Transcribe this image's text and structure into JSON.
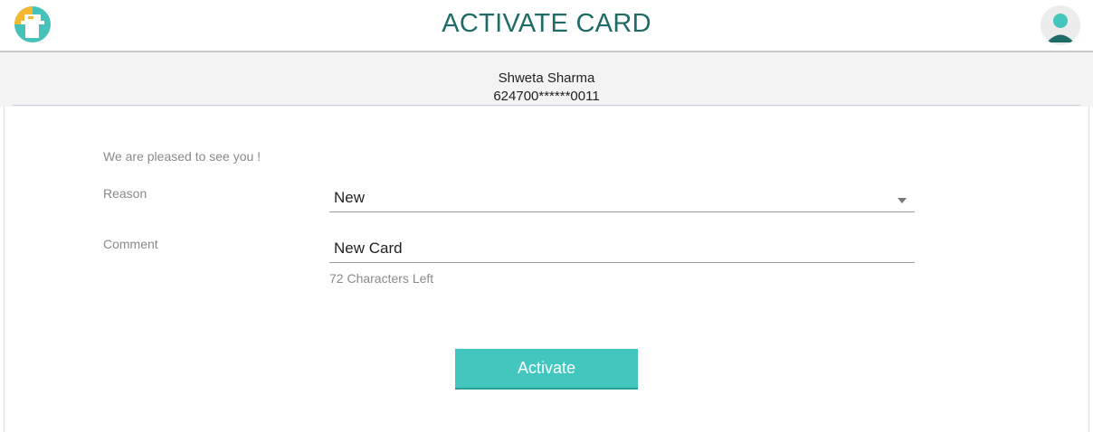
{
  "header": {
    "title": "ACTIVATE CARD",
    "logo_icon": "card-logo-icon",
    "avatar_icon": "user-avatar-icon",
    "colors": {
      "title": "#1f6b68",
      "logo_orange": "#f5b731",
      "logo_teal": "#46c2bb"
    }
  },
  "card": {
    "holder": "Shweta Sharma",
    "number": "624700******0011"
  },
  "form": {
    "greeting": "We are pleased to see you !",
    "reason_label": "Reason",
    "reason_value": "New",
    "comment_label": "Comment",
    "comment_value": "New Card",
    "chars_left": "72 Characters Left",
    "activate_label": "Activate",
    "colors": {
      "button": "#42c6be"
    }
  }
}
